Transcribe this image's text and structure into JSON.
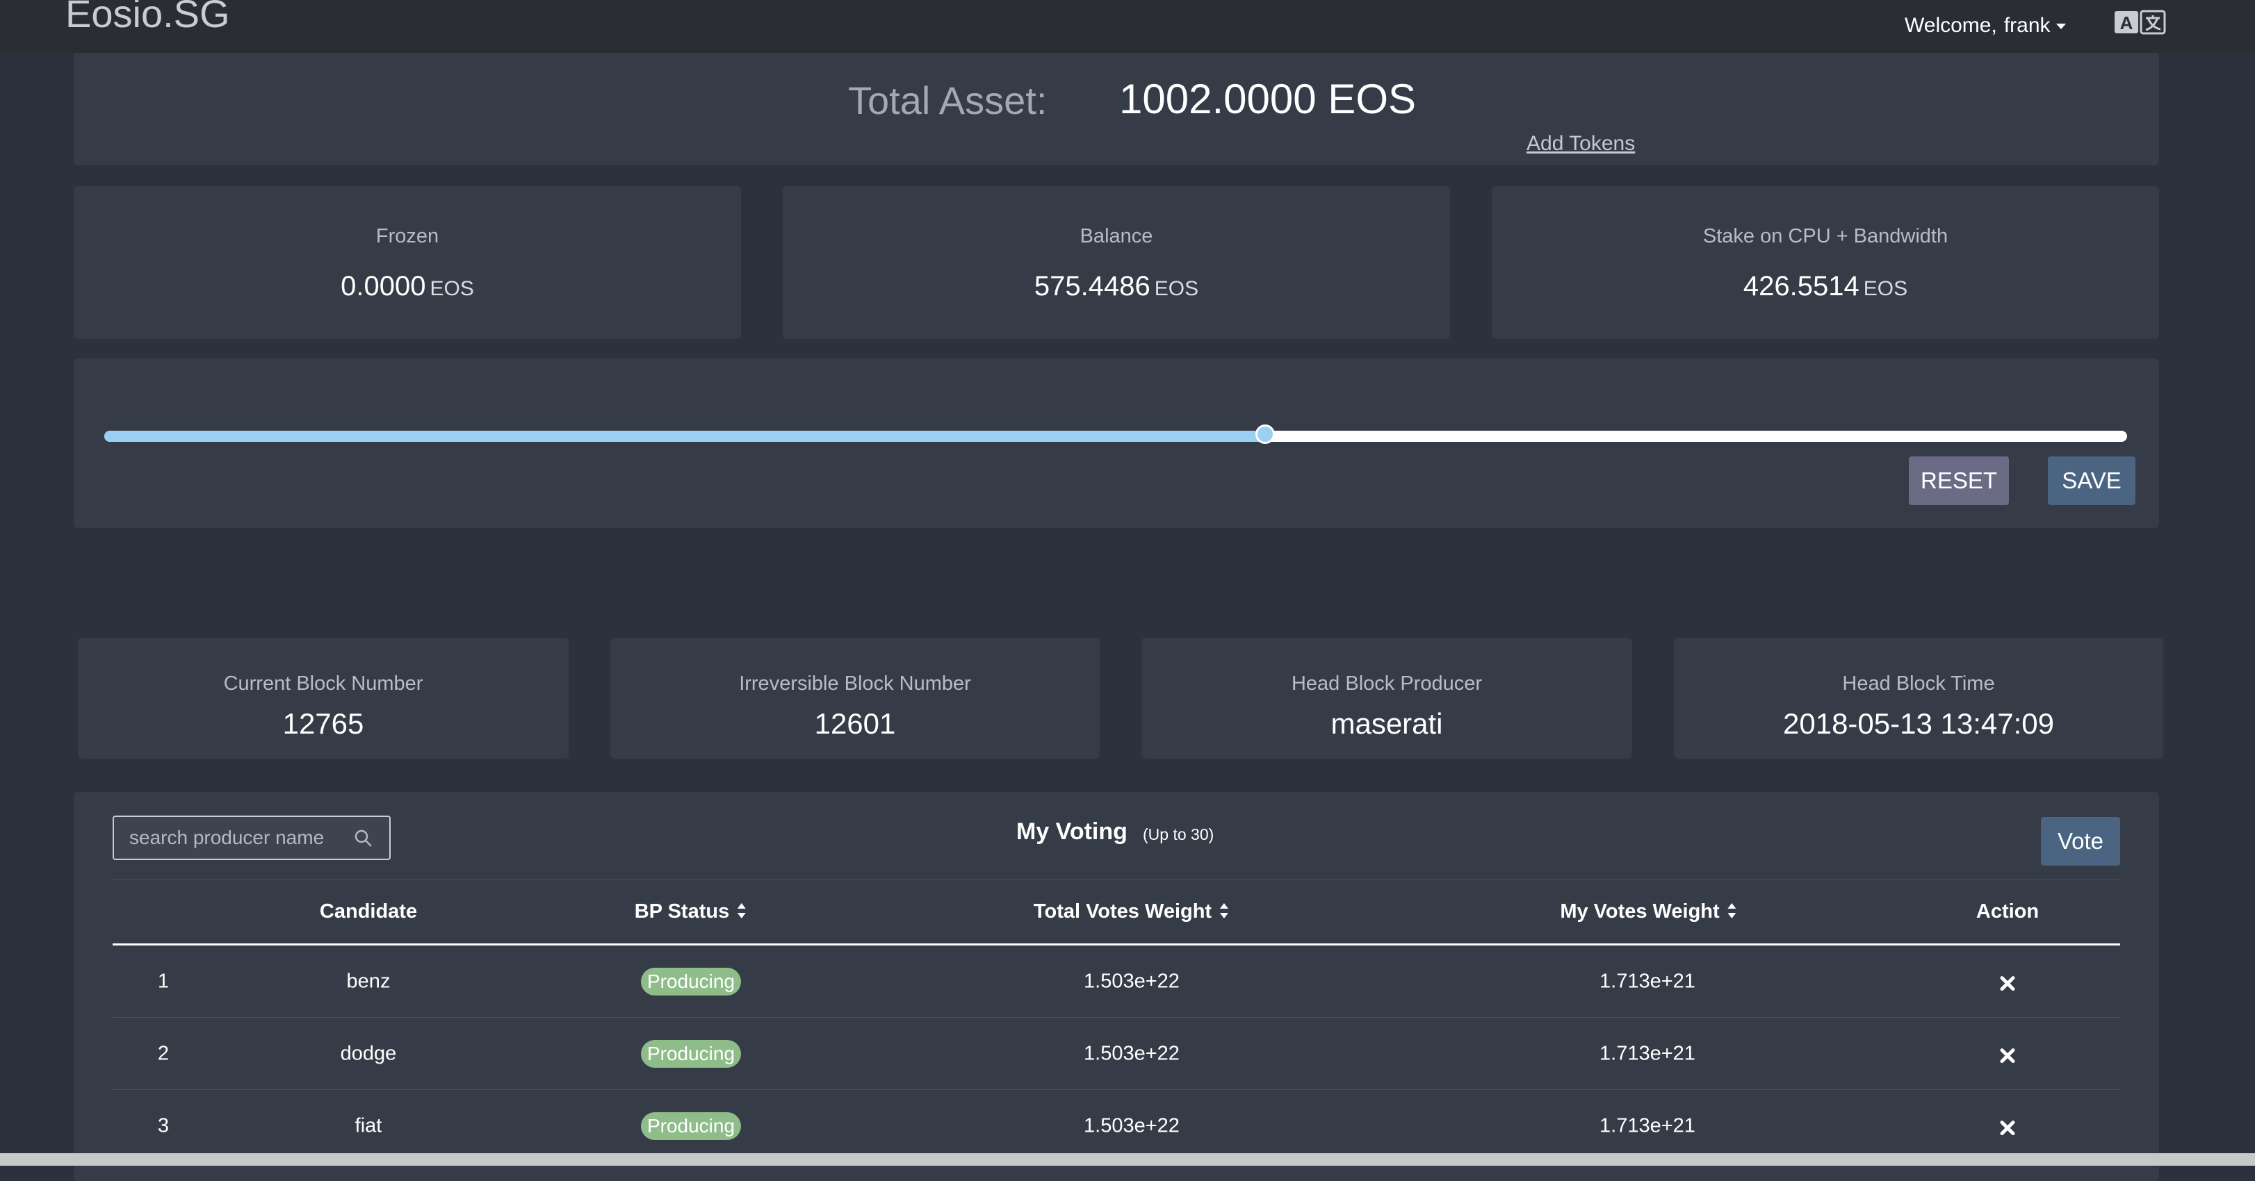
{
  "app": {
    "brand": "Eosio.SG",
    "welcome_text": "Welcome,",
    "username": "frank"
  },
  "asset": {
    "total_label": "Total Asset:",
    "total_value": "1002.0000 EOS",
    "add_tokens": "Add Tokens"
  },
  "balances": [
    {
      "label": "Frozen",
      "value": "0.0000",
      "unit": "EOS"
    },
    {
      "label": "Balance",
      "value": "575.4486",
      "unit": "EOS"
    },
    {
      "label": "Stake on CPU + Bandwidth",
      "value": "426.5514",
      "unit": "EOS"
    }
  ],
  "stake_slider": {
    "fraction": 0.574,
    "reset_label": "RESET",
    "save_label": "SAVE"
  },
  "blocks": [
    {
      "label": "Current Block Number",
      "value": "12765"
    },
    {
      "label": "Irreversible Block Number",
      "value": "12601"
    },
    {
      "label": "Head Block Producer",
      "value": "maserati"
    },
    {
      "label": "Head Block Time",
      "value": "2018-05-13 13:47:09"
    }
  ],
  "voting": {
    "search_placeholder": "search producer name",
    "title": "My Voting",
    "subtitle": "(Up to 30)",
    "vote_label": "Vote",
    "columns": [
      "Candidate",
      "BP Status",
      "Total Votes Weight",
      "My Votes Weight",
      "Action"
    ],
    "rows": [
      {
        "index": "1",
        "candidate": "benz",
        "status": "Producing",
        "total_votes": "1.503e+22",
        "my_votes": "1.713e+21"
      },
      {
        "index": "2",
        "candidate": "dodge",
        "status": "Producing",
        "total_votes": "1.503e+22",
        "my_votes": "1.713e+21"
      },
      {
        "index": "3",
        "candidate": "fiat",
        "status": "Producing",
        "total_votes": "1.503e+22",
        "my_votes": "1.713e+21"
      }
    ]
  },
  "colors": {
    "background": "#2b323d",
    "panel": "#353c48",
    "slider_fill": "#9bd0f3",
    "status_badge": "#8fbd8a",
    "save_button": "#4a6482",
    "reset_button": "#6b6b86"
  }
}
